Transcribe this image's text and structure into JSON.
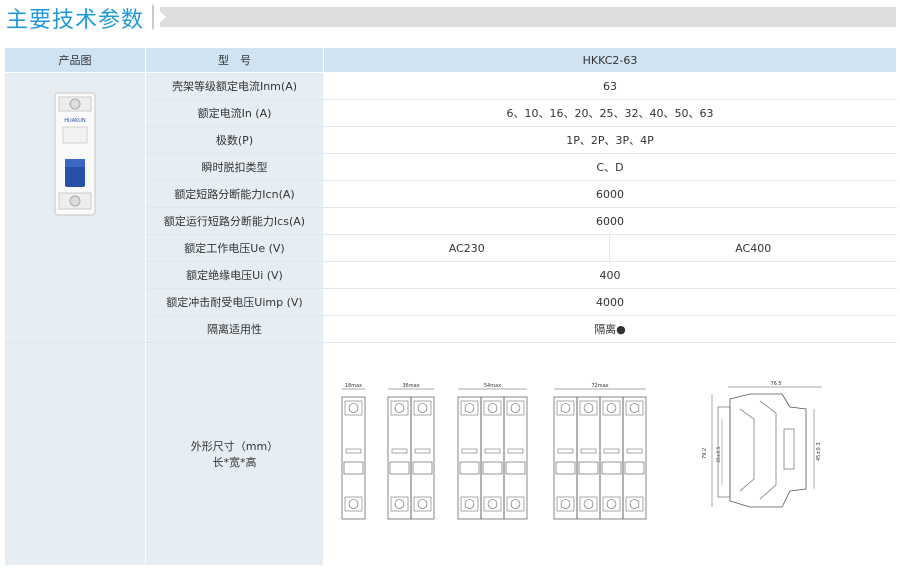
{
  "header": {
    "title": "主要技术参数"
  },
  "table": {
    "col_headers": {
      "image": "产品图",
      "param": "型　号",
      "model": "HKKC2-63"
    },
    "rows": [
      {
        "label": "壳架等级额定电流Inm(A)",
        "value": "63"
      },
      {
        "label": "额定电流In (A)",
        "value": "6、10、16、20、25、32、40、50、63"
      },
      {
        "label": "极数(P)",
        "value": "1P、2P、3P、4P"
      },
      {
        "label": "瞬时脱扣类型",
        "value": "C、D"
      },
      {
        "label": "额定短路分断能力Icn(A)",
        "value": "6000"
      },
      {
        "label": "额定运行短路分断能力Ics(A)",
        "value": "6000"
      },
      {
        "label": "额定工作电压Ue (V)",
        "value_a": "AC230",
        "value_b": "AC400"
      },
      {
        "label": "额定绝缘电压Ui (V)",
        "value": "400"
      },
      {
        "label": "额定冲击耐受电压Uimp (V)",
        "value": "4000"
      },
      {
        "label": "隔离适用性",
        "value": "隔离●"
      }
    ],
    "dims": {
      "label_line1": "外形尺寸（mm）",
      "label_line2": "长*宽*高"
    }
  },
  "product": {
    "brand": "HUAKUN"
  },
  "drawing": {
    "widths": [
      "18max",
      "36max",
      "54max",
      "72max"
    ],
    "side_labels": [
      "76.5",
      "79.2",
      "35±0.5",
      "45±0.3"
    ]
  },
  "colors": {
    "accent": "#1f9ad6",
    "header_row": "#cfe3f2",
    "label_col": "#e7eef3",
    "breaker_handle": "#2a4fa8"
  }
}
